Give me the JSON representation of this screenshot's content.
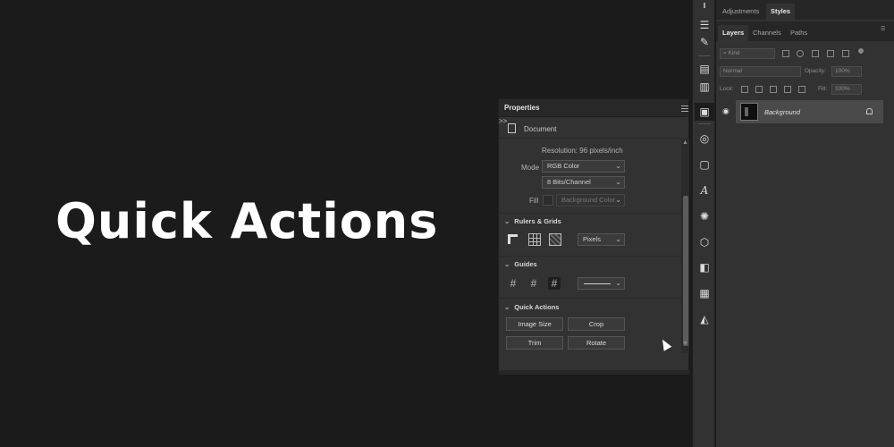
{
  "hero": {
    "title": "Quick Actions"
  },
  "properties": {
    "title": "Properties",
    "collapse_glyph": ">>",
    "document_label": "Document",
    "resolution": "Resolution: 96 pixels/inch",
    "mode_label": "Mode",
    "mode_value": "RGB Color",
    "bits_value": "8 Bits/Channel",
    "fill_label": "Fill",
    "fill_value": "Background Color",
    "rulers_grids_title": "Rulers & Grids",
    "units_value": "Pixels",
    "guides_title": "Guides",
    "quick_actions_title": "Quick Actions",
    "buttons": {
      "image_size": "Image Size",
      "crop": "Crop",
      "trim": "Trim",
      "rotate": "Rotate"
    }
  },
  "right_panel": {
    "top_tabs": [
      "Adjustments",
      "Styles"
    ],
    "layer_tabs": [
      "Layers",
      "Channels",
      "Paths"
    ],
    "kind_placeholder": "Kind",
    "blend_mode": "Normal",
    "opacity_label": "Opacity:",
    "opacity_value": "100%",
    "lock_label": "Lock:",
    "fill_label": "Fill:",
    "fill_value": "100%",
    "layer_name": "Background"
  },
  "toolbar": {
    "icons": [
      "properties-sliders-icon",
      "brush-icon",
      "history-icon",
      "notes-icon",
      "properties-icon",
      "navigator-icon",
      "swatches-icon",
      "character-icon",
      "glyph-icon",
      "3d-icon",
      "gradient-icon",
      "grid-icon",
      "shapes-icon"
    ]
  }
}
